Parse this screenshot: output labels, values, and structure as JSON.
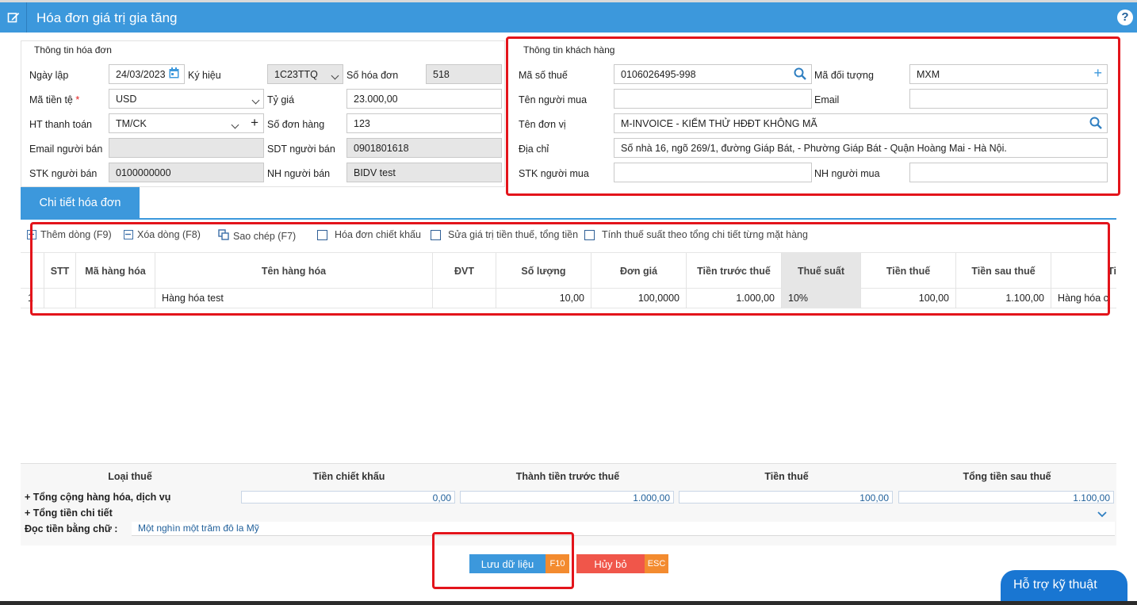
{
  "header": {
    "title": "Hóa đơn giá trị gia tăng",
    "help": "?"
  },
  "invoice_info": {
    "title": "Thông tin hóa đơn",
    "ngay_lap_label": "Ngày lập",
    "ngay_lap": "24/03/2023",
    "ky_hieu_label": "Ký hiệu",
    "ky_hieu": "1C23TTQ",
    "so_hoa_don_label": "Số hóa đơn",
    "so_hoa_don": "518",
    "ma_tien_te_label": "Mã tiền tệ",
    "ma_tien_te": "USD",
    "ty_gia_label": "Tỷ giá",
    "ty_gia": "23.000,00",
    "ht_thanh_toan_label": "HT thanh toán",
    "ht_thanh_toan": "TM/CK",
    "so_don_hang_label": "Số đơn hàng",
    "so_don_hang": "123",
    "email_nguoi_ban_label": "Email người bán",
    "email_nguoi_ban": "",
    "sdt_nguoi_ban_label": "SDT người bán",
    "sdt_nguoi_ban": "0901801618",
    "stk_nguoi_ban_label": "STK người bán",
    "stk_nguoi_ban": "0100000000",
    "nh_nguoi_ban_label": "NH người bán",
    "nh_nguoi_ban": "BIDV test"
  },
  "customer_info": {
    "title": "Thông tin khách hàng",
    "ma_so_thue_label": "Mã số thuế",
    "ma_so_thue": "0106026495-998",
    "ma_doi_tuong_label": "Mã đối tượng",
    "ma_doi_tuong": "MXM",
    "ten_nguoi_mua_label": "Tên người mua",
    "ten_nguoi_mua": "",
    "email_label": "Email",
    "email": "",
    "ten_don_vi_label": "Tên đơn vị",
    "ten_don_vi": "M-INVOICE - KIỂM THỬ HĐĐT KHÔNG MÃ",
    "dia_chi_label": "Địa chỉ",
    "dia_chi": "Số nhà 16, ngõ 269/1, đường Giáp Bát, - Phường Giáp Bát - Quận Hoàng Mai - Hà Nội.",
    "stk_nguoi_mua_label": "STK người mua",
    "stk_nguoi_mua": "",
    "nh_nguoi_mua_label": "NH người mua",
    "nh_nguoi_mua": ""
  },
  "tab": {
    "label": "Chi tiết hóa đơn"
  },
  "toolbar": {
    "add": "Thêm dòng (F9)",
    "delete": "Xóa dòng (F8)",
    "copy": "Sao chép (F7)",
    "discount": "Hóa đơn chiết khấu",
    "edit_tax": "Sửa giá trị tiền thuế, tổng tiền",
    "calc_tax": "Tính thuế suất theo tổng chi tiết từng mặt hàng"
  },
  "grid": {
    "columns": [
      "STT",
      "Mã hàng hóa",
      "Tên hàng hóa",
      "ĐVT",
      "Số lượng",
      "Đơn giá",
      "Tiền trước thuế",
      "Thuế suất",
      "Tiền thuế",
      "Tiền sau thuế",
      "Ti"
    ],
    "rows": [
      {
        "index": "1",
        "stt": "",
        "ma_hang": "",
        "ten_hang": "Hàng hóa test",
        "dvt": "",
        "so_luong": "10,00",
        "don_gia": "100,0000",
        "tien_truoc_thue": "1.000,00",
        "thue_suat": "10%",
        "tien_thue": "100,00",
        "tien_sau_thue": "1.100,00",
        "extra": "Hàng hóa c"
      }
    ]
  },
  "summary": {
    "headers": [
      "Loại thuế",
      "Tiền chiết khấu",
      "Thành tiền trước thuế",
      "Tiền thuế",
      "Tổng tiền sau thuế"
    ],
    "total_goods_label": "+ Tổng cộng hàng hóa, dịch vụ",
    "chiet_khau": "0,00",
    "truoc_thue": "1.000,00",
    "tien_thue": "100,00",
    "sau_thue": "1.100,00",
    "total_detail_label": "+ Tổng tiền chi tiết",
    "words_label": "Đọc tiền bằng chữ :",
    "words": "Một nghìn một trăm đô la Mỹ"
  },
  "actions": {
    "save": "Lưu dữ liệu",
    "save_key": "F10",
    "cancel": "Hủy bỏ",
    "cancel_key": "ESC"
  },
  "support": "Hỗ trợ kỹ thuật",
  "colors": {
    "primary": "#3c98dc",
    "save": "#3c98dc",
    "cancel": "#f0564a",
    "key": "#f38b2f",
    "annotation": "#e3141b"
  }
}
